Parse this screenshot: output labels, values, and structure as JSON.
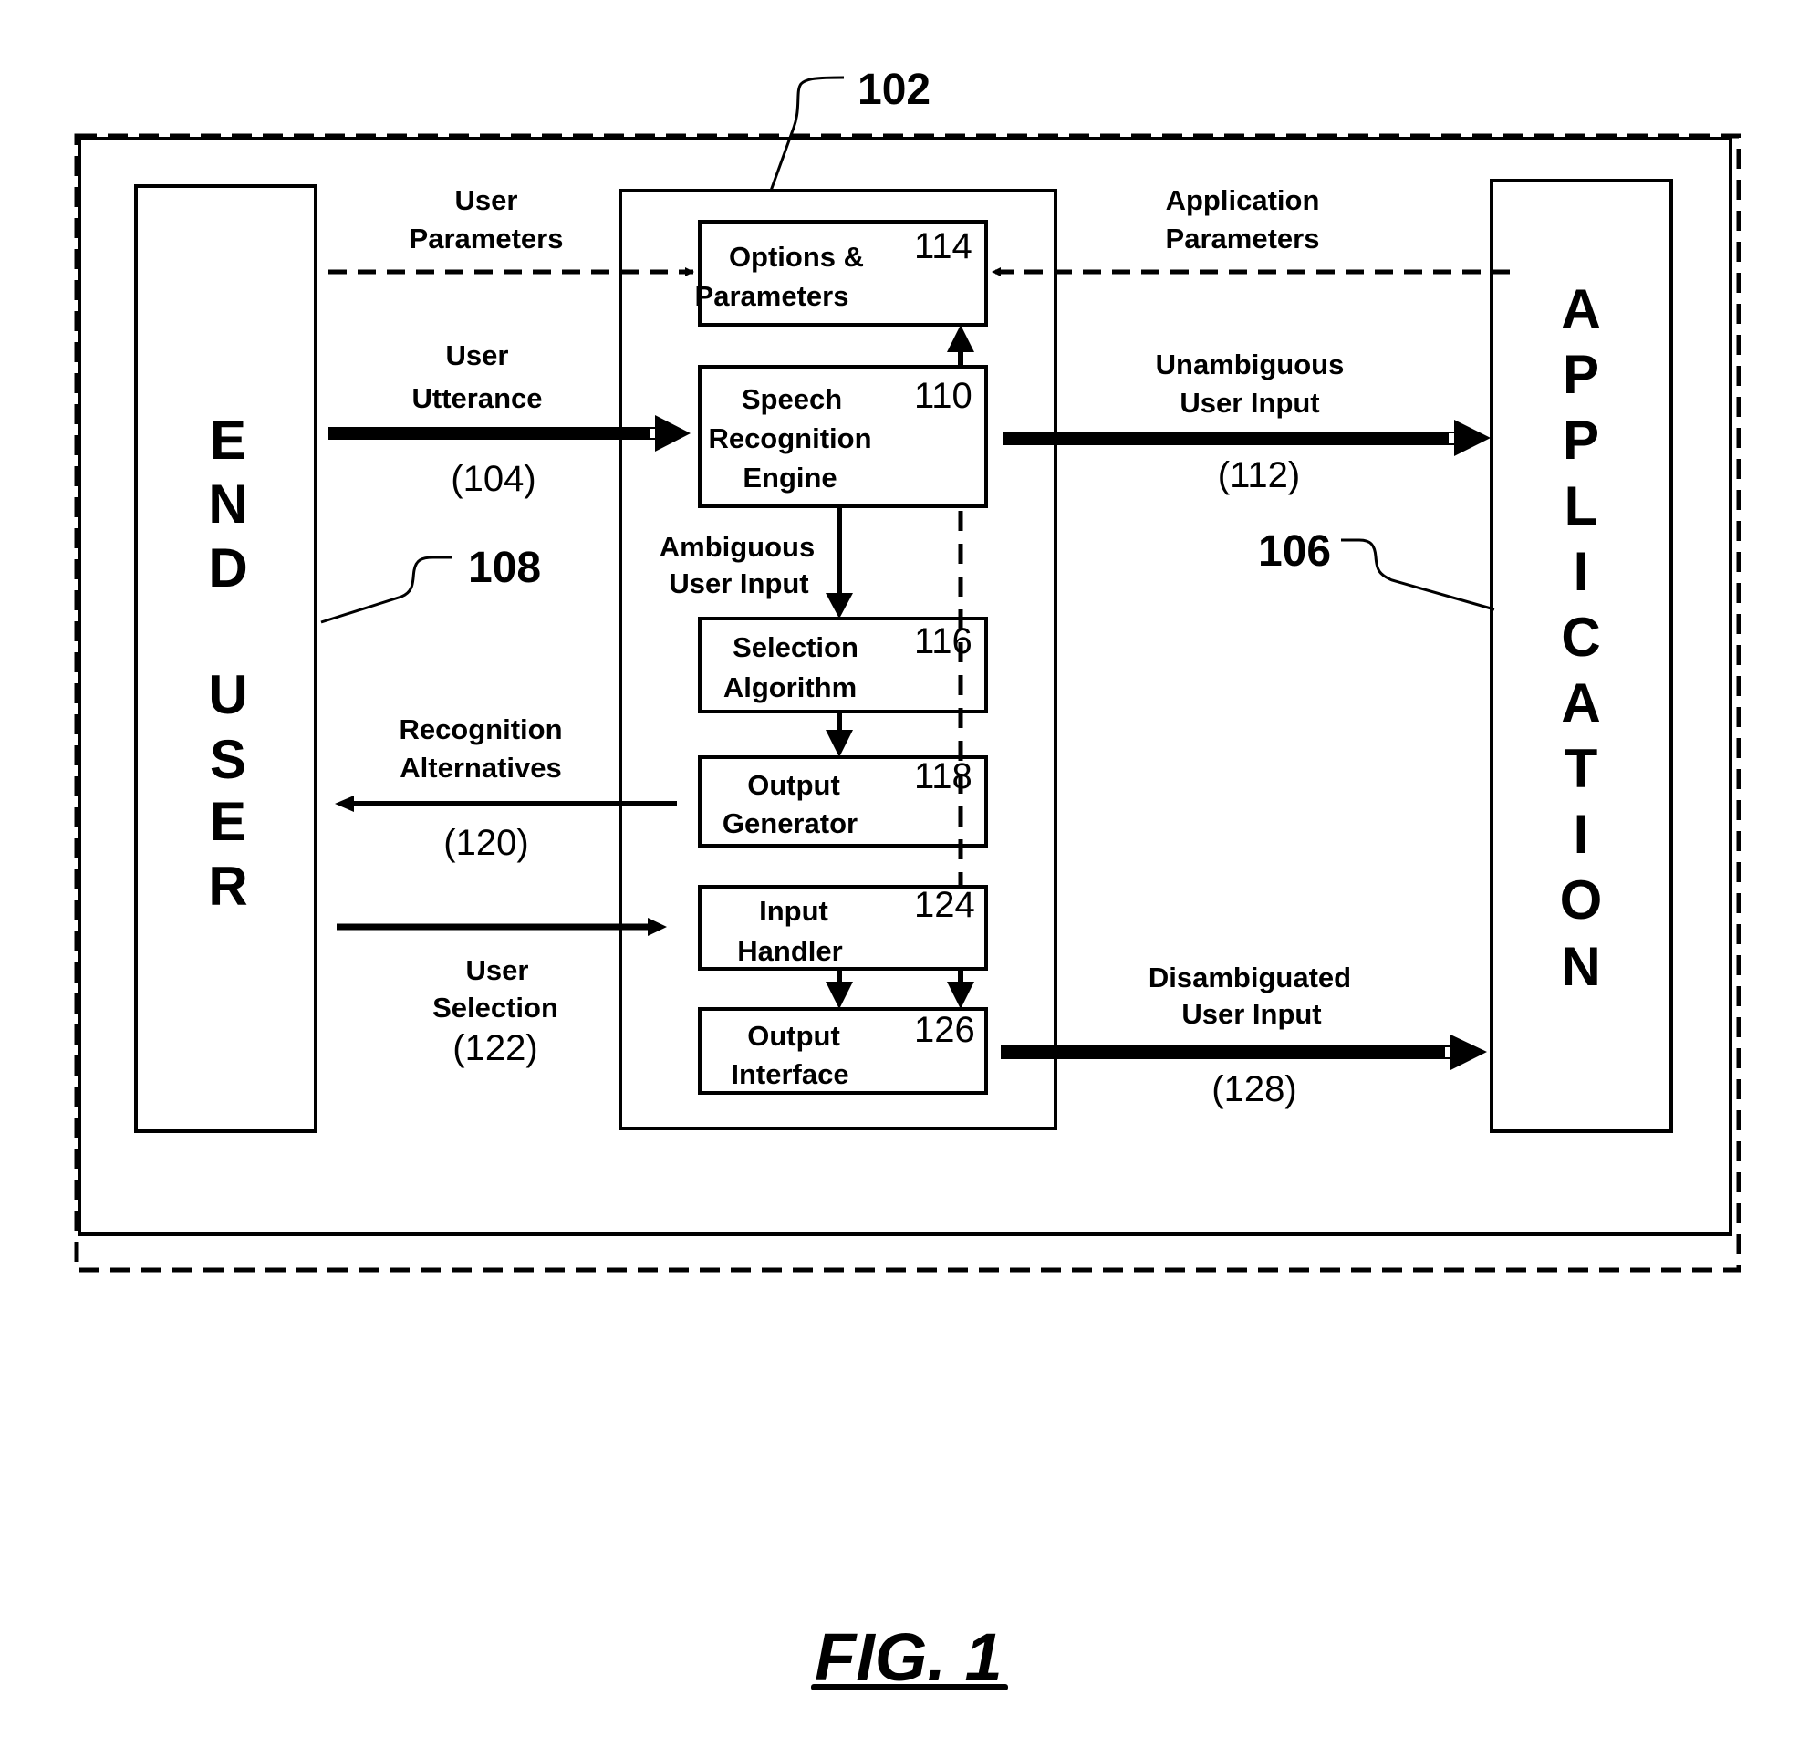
{
  "figure": {
    "caption": "FIG. 1",
    "system_ref": "102",
    "end_user": {
      "ref": "108",
      "letters": [
        "E",
        "N",
        "D",
        "U",
        "S",
        "E",
        "R"
      ],
      "label": "END USER"
    },
    "application": {
      "ref": "106",
      "letters": [
        "A",
        "P",
        "P",
        "L",
        "I",
        "C",
        "A",
        "T",
        "I",
        "O",
        "N"
      ],
      "label": "APPLICATION"
    },
    "components": [
      {
        "id": "options",
        "lines": [
          "Options &",
          "Parameters"
        ],
        "ref": "114"
      },
      {
        "id": "speech",
        "lines": [
          "Speech",
          "Recognition",
          "Engine"
        ],
        "ref": "110"
      },
      {
        "id": "selection",
        "lines": [
          "Selection",
          "Algorithm"
        ],
        "ref": "116"
      },
      {
        "id": "output-generator",
        "lines": [
          "Output",
          "Generator"
        ],
        "ref": "118"
      },
      {
        "id": "input-handler",
        "lines": [
          "Input",
          "Handler"
        ],
        "ref": "124"
      },
      {
        "id": "output-interface",
        "lines": [
          "Output",
          "Interface"
        ],
        "ref": "126"
      }
    ],
    "flows": {
      "user_parameters": {
        "lines": [
          "User",
          "Parameters"
        ]
      },
      "application_parameters": {
        "lines": [
          "Application",
          "Parameters"
        ]
      },
      "user_utterance": {
        "lines": [
          "User",
          "Utterance"
        ],
        "ref": "(104)"
      },
      "unambiguous": {
        "lines": [
          "Unambiguous",
          "User Input"
        ],
        "ref": "(112)"
      },
      "ambiguous": {
        "lines": [
          "Ambiguous",
          "User Input"
        ]
      },
      "recognition_alternatives": {
        "lines": [
          "Recognition",
          "Alternatives"
        ],
        "ref": "(120)"
      },
      "user_selection": {
        "lines": [
          "User",
          "Selection"
        ],
        "ref": "(122)"
      },
      "disambiguated": {
        "lines": [
          "Disambiguated",
          "User Input"
        ],
        "ref": "(128)"
      }
    }
  }
}
